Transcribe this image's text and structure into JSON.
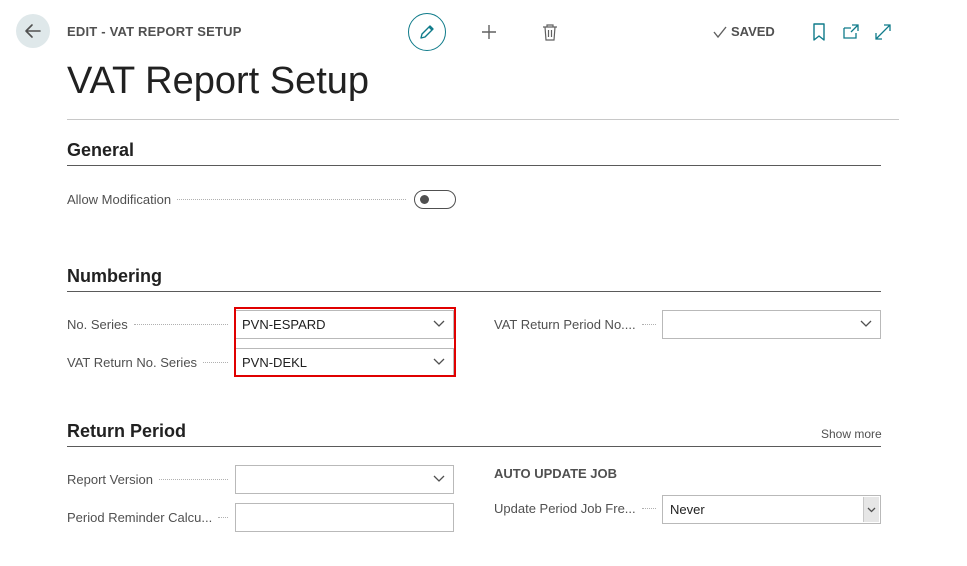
{
  "header": {
    "breadcrumb": "EDIT - VAT REPORT SETUP",
    "saved_label": "SAVED",
    "icons": [
      "back-arrow-icon",
      "pencil-icon",
      "plus-icon",
      "trash-icon",
      "checkmark-icon",
      "bookmark-icon",
      "open-new-window-icon",
      "expand-icon"
    ]
  },
  "page": {
    "title": "VAT Report Setup"
  },
  "general": {
    "title": "General",
    "allow_modification": {
      "label": "Allow Modification",
      "value": false
    }
  },
  "numbering": {
    "title": "Numbering",
    "no_series": {
      "label": "No. Series",
      "value": "PVN-ESPARD"
    },
    "vat_return_no_series": {
      "label": "VAT Return No. Series",
      "value": "PVN-DEKL"
    },
    "vat_return_period_no": {
      "label": "VAT Return Period No....",
      "value": ""
    }
  },
  "return_period": {
    "title": "Return Period",
    "show_more": "Show more",
    "report_version": {
      "label": "Report Version",
      "value": ""
    },
    "period_reminder": {
      "label": "Period Reminder Calcu...",
      "value": ""
    },
    "auto_update_job": "AUTO UPDATE JOB",
    "update_period_job_freq": {
      "label": "Update Period Job Fre...",
      "value": "Never"
    }
  },
  "colors": {
    "accent": "#0f7b8a",
    "highlight": "#e00000",
    "back_button_bg": "#dfe8ea"
  }
}
